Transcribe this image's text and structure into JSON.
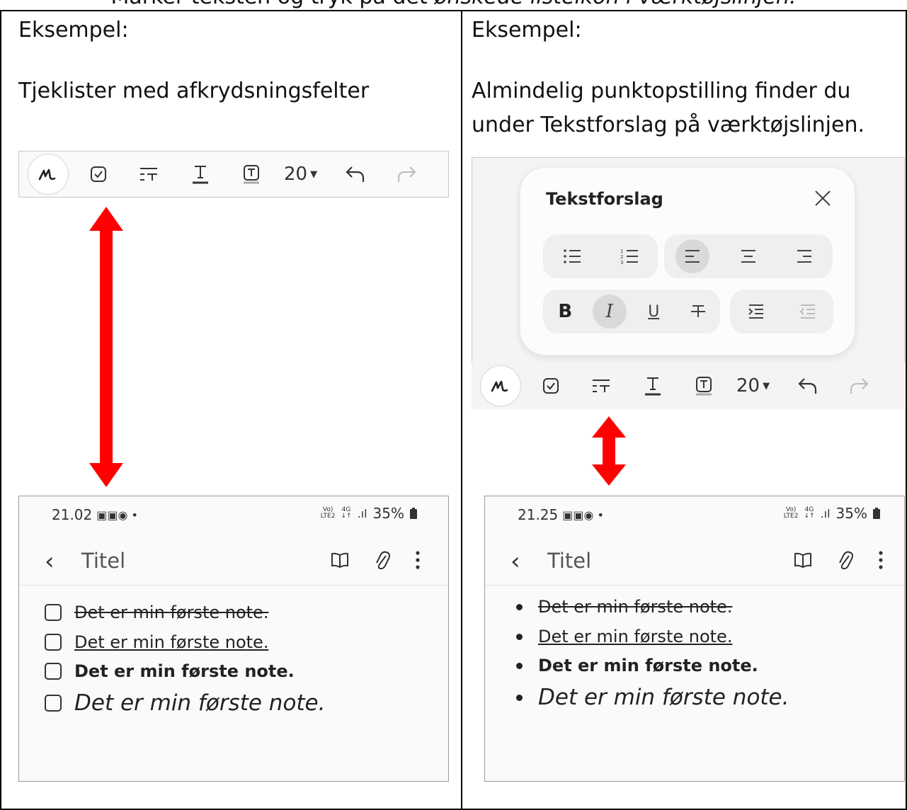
{
  "top_caption": {
    "before": "Markér teksten og tryk på det ",
    "italic": "ønskede listeikon i værktøjslinjen."
  },
  "left": {
    "example_label": "Eksempel:",
    "description": "Tjeklister med afkrydsningsfelter"
  },
  "right": {
    "example_label": "Eksempel:",
    "description_line1": "Almindelig punktopstilling finder du",
    "description_line2": "under Tekstforslag på værktøjslinjen."
  },
  "toolbar": {
    "font_size": "20"
  },
  "popup": {
    "title": "Tekstforslag",
    "bold_label": "B",
    "italic_label": "I",
    "underline_label": "U"
  },
  "phone_left": {
    "time": "21.02",
    "battery": "35%",
    "title": "Titel"
  },
  "phone_right": {
    "time": "21.25",
    "battery": "35%",
    "title": "Titel"
  },
  "note_lines": [
    "Det er min første note.",
    "Det er min første note.",
    "Det er min første note.",
    "Det er min første note."
  ],
  "colors": {
    "arrow": "#ff0000"
  }
}
